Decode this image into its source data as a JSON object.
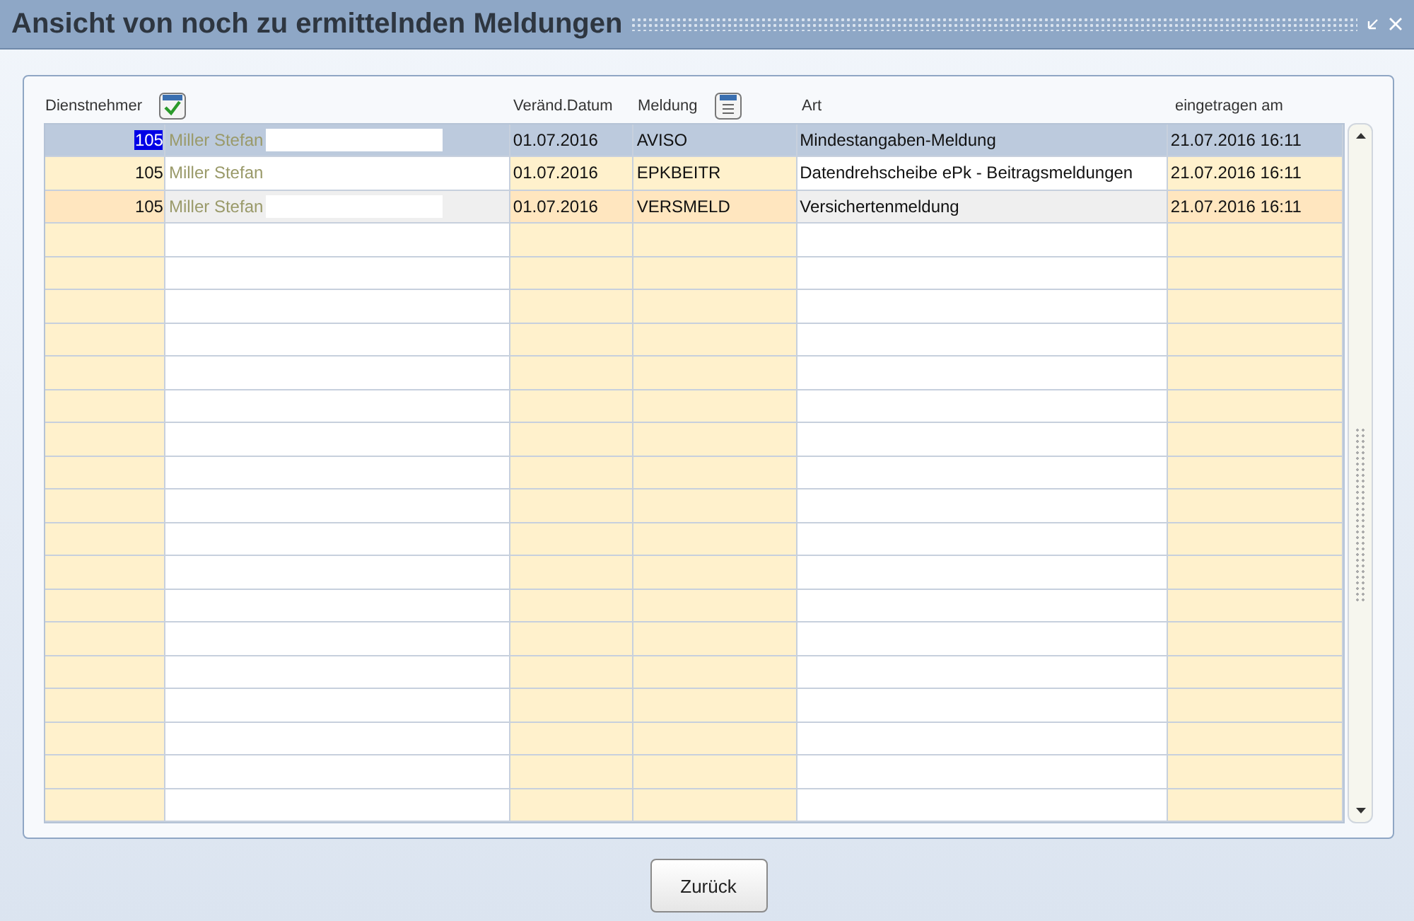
{
  "window": {
    "title": "Ansicht von noch zu ermittelnden Meldungen"
  },
  "table": {
    "columns": [
      "Dienstnehmer",
      "Veränd.Datum",
      "Meldung",
      "Art",
      "eingetragen am"
    ],
    "rows": [
      {
        "number": "105",
        "name": "Miller Stefan",
        "date": "01.07.2016",
        "meldung": "AVISO",
        "art": "Mindestangaben-Meldung",
        "entered": "21.07.2016 16:11",
        "selected": true,
        "highlighted": false
      },
      {
        "number": "105",
        "name": "Miller Stefan",
        "date": "01.07.2016",
        "meldung": "EPKBEITR",
        "art": "Datendrehscheibe ePk - Beitragsmeldungen",
        "entered": "21.07.2016 16:11",
        "selected": false,
        "highlighted": false
      },
      {
        "number": "105",
        "name": "Miller Stefan",
        "date": "01.07.2016",
        "meldung": "VERSMELD",
        "art": "Versichertenmeldung",
        "entered": "21.07.2016 16:11",
        "selected": false,
        "highlighted": true
      }
    ]
  },
  "buttons": [
    "Zurück"
  ]
}
